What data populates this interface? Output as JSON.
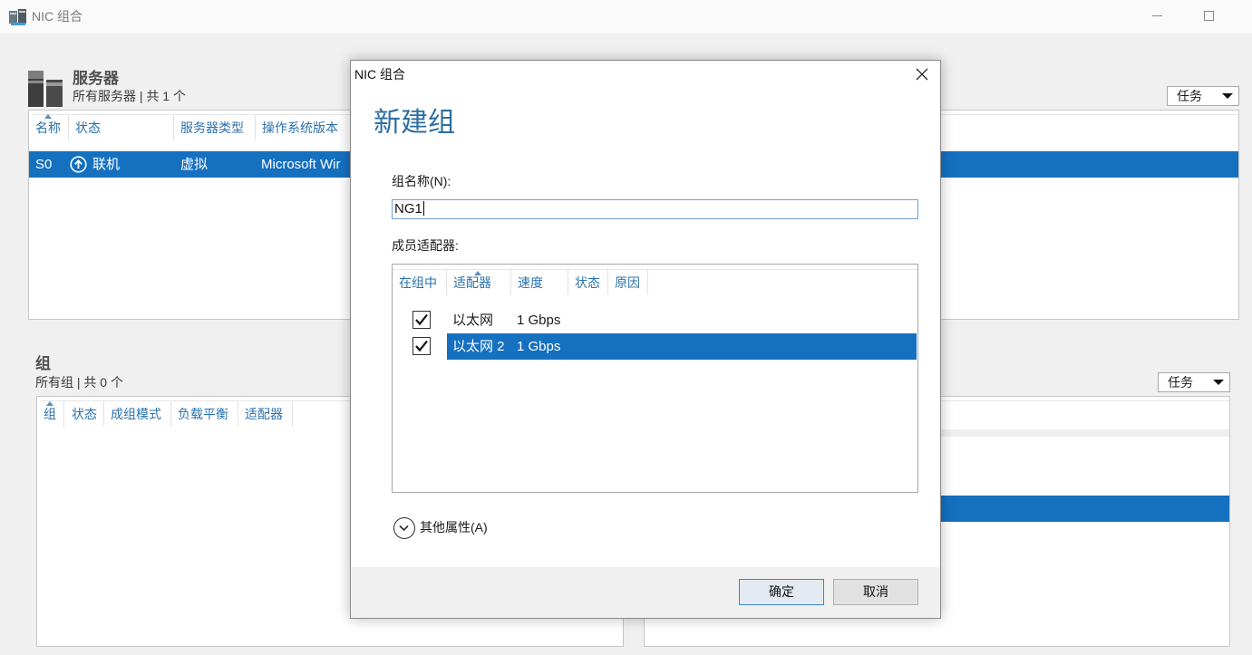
{
  "window": {
    "title": "NIC 组合"
  },
  "colors": {
    "selection": "#1570c0",
    "column_header": "#2a72ad",
    "dialog_heading": "#2b6e9f"
  },
  "servers": {
    "heading": "服务器",
    "subheading": "所有服务器 | 共 1 个",
    "tasks_label": "任务",
    "sort_icon": "sort-ascending-icon",
    "columns": [
      "名称",
      "状态",
      "服务器类型",
      "操作系统版本"
    ],
    "rows": [
      {
        "name": "S0",
        "status_icon": "online-up-arrow-icon",
        "status": "联机",
        "server_type": "虚拟",
        "os_version": "Microsoft Wir",
        "selected": true
      }
    ]
  },
  "teams": {
    "heading": "组",
    "subheading": "所有组 | 共 0 个",
    "sort_icon": "sort-ascending-icon",
    "columns": [
      "组",
      "状态",
      "成组模式",
      "负载平衡",
      "适配器"
    ],
    "rows": []
  },
  "adapters": {
    "tasks_label": "任务"
  },
  "dialog": {
    "title": "NIC 组合",
    "heading": "新建组",
    "team_name": {
      "label": "组名称(N):",
      "value": "NG1"
    },
    "members": {
      "label": "成员适配器:",
      "sort_icon": "sort-ascending-icon",
      "columns": [
        "在组中",
        "适配器",
        "速度",
        "状态",
        "原因"
      ],
      "rows": [
        {
          "in_team": true,
          "adapter": "以太网",
          "speed": "1 Gbps",
          "selected": false
        },
        {
          "in_team": true,
          "adapter": "以太网 2",
          "speed": "1 Gbps",
          "selected": true
        }
      ]
    },
    "additional_properties_label": "其他属性(A)",
    "ok_label": "确定",
    "cancel_label": "取消"
  }
}
